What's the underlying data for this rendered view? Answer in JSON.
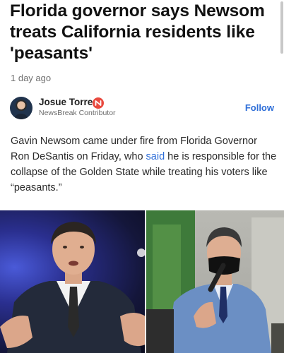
{
  "article": {
    "title": "Florida governor says Newsom treats California residents like 'peasants'",
    "timestamp": "1 day ago"
  },
  "author": {
    "name": "Josue Torres",
    "role": "NewsBreak Contributor",
    "badge_icon": "newsbreak-badge-icon",
    "follow_label": "Follow"
  },
  "body": {
    "part1": "Gavin Newsom came under fire from Florida Governor Ron DeSantis on Friday, who ",
    "link": "said",
    "part2": " he is responsible for the collapse of the Golden State while treating his voters like “peasants.”"
  },
  "colors": {
    "link": "#2e6ed8",
    "badge": "#e94a3f"
  }
}
